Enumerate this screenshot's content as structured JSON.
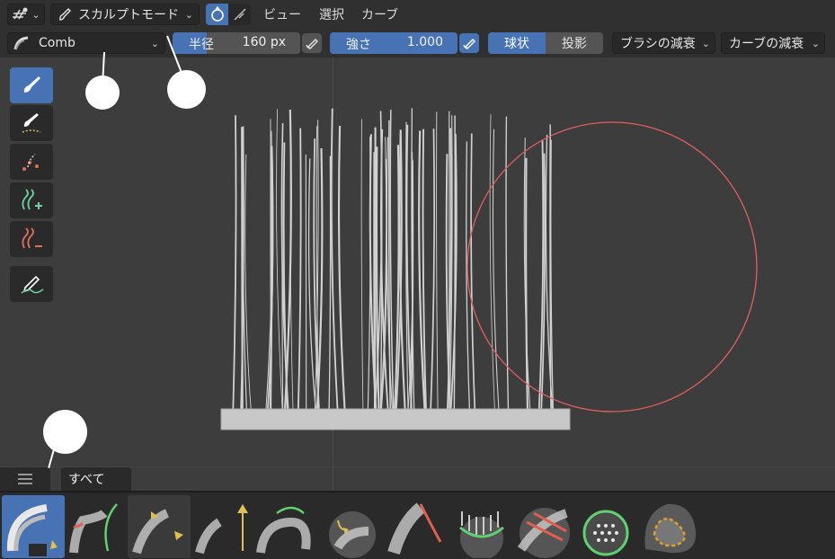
{
  "header": {
    "mode_label": "スカルプトモード",
    "menus": [
      "ビュー",
      "選択",
      "カーブ"
    ]
  },
  "toolsettings": {
    "brush_name": "Comb",
    "radius_label": "半径",
    "radius_value": "160 px",
    "strength_label": "強さ",
    "strength_value": "1.000",
    "falloff_shape_options": [
      "球状",
      "投影"
    ],
    "falloff_shape_selected": "球状",
    "brush_falloff_label": "ブラシの減衰",
    "curve_falloff_label": "カーブの減衰"
  },
  "toolbar": {
    "tools": [
      "brush-tool-icon",
      "annotate-brush-icon",
      "draw-points-icon",
      "add-curves-icon",
      "delete-curves-icon",
      "annotate-pen-icon"
    ]
  },
  "shelf": {
    "tab_label": "すべて",
    "assets": [
      "comb-brush",
      "add-brush",
      "pinch-brush",
      "grow-shrink-brush",
      "snake-hook-brush",
      "slide-brush",
      "puff-brush",
      "density-brush",
      "cut-brush",
      "smooth-brush",
      "select-brush",
      "selection-paint-brush"
    ]
  },
  "colors": {
    "accent": "#4772b3",
    "header_bg": "#303030",
    "viewport_bg": "#3d3d3d",
    "brush_cursor": "#e06060",
    "hair": "#d9d9d9"
  }
}
